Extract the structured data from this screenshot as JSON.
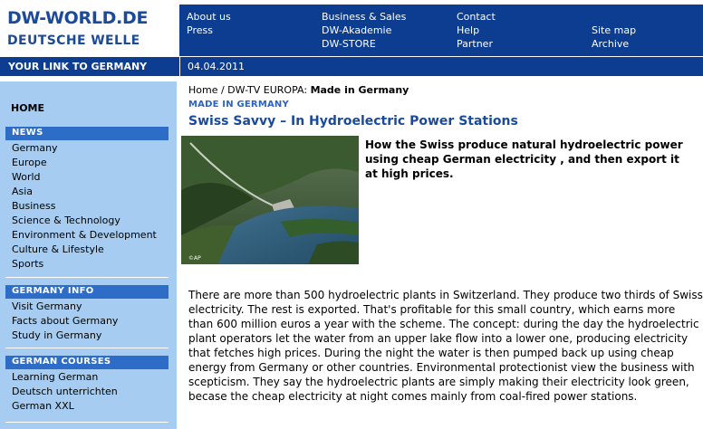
{
  "header": {
    "logo_line1": "DW-WORLD.DE",
    "logo_line2": "DEUTSCHE WELLE",
    "tagline": "YOUR LINK TO GERMANY",
    "date": "04.04.2011",
    "nav_col1": [
      "About us",
      "Press"
    ],
    "nav_col2": [
      "Business & Sales",
      "DW-Akademie",
      "DW-STORE"
    ],
    "nav_col3": [
      "Contact",
      "Help",
      "Partner"
    ],
    "nav_col4": [
      "Site map",
      "Archive"
    ]
  },
  "sidebar": {
    "home": "HOME",
    "news_heading": "NEWS",
    "news_items": [
      "Germany",
      "Europe",
      "World",
      "Asia",
      "Business",
      "Science & Technology",
      "Environment & Development",
      "Culture & Lifestyle",
      "Sports"
    ],
    "info_heading": "GERMANY INFO",
    "info_items": [
      "Visit Germany",
      "Facts about Germany",
      "Study in Germany"
    ],
    "courses_heading": "GERMAN COURSES",
    "courses_items": [
      "Learning German",
      "Deutsch unterrichten",
      "German XXL"
    ]
  },
  "article": {
    "breadcrumb_home": "Home",
    "breadcrumb_mid": " / DW-TV EUROPA: ",
    "breadcrumb_current": "Made in Germany",
    "section": "MADE IN GERMANY",
    "title": "Swiss Savvy – In Hydroelectric Power Stations",
    "photo_credit": "©AP",
    "intro": "How the Swiss produce natural hydroelectric power using cheap German electricity , and then export it at high prices.",
    "body": "There are more than 500 hydroelectric plants in Switzerland. They produce two thirds of Swiss electricity. The rest is exported. That's profitable for this small country, which earns more than 600 million euros a year with the scheme. The concept: during the day the hydroelectric plant operators let the water from an upper lake flow into a lower one, producing electricity that fetches high prices. During the night the water is then pumped back up using cheap energy from Germany or other countries. Environmental protectionist view the business with scepticism. They say the hydroelectric plants are simply making their electricity look green, becase the cheap electricity at night comes mainly from coal-fired power stations."
  },
  "colors": {
    "brand_blue": "#0c3d91",
    "sidebar_bg": "#a6cdf1",
    "sidebar_heading": "#2d6cc7",
    "title_blue": "#1a4a9a"
  }
}
